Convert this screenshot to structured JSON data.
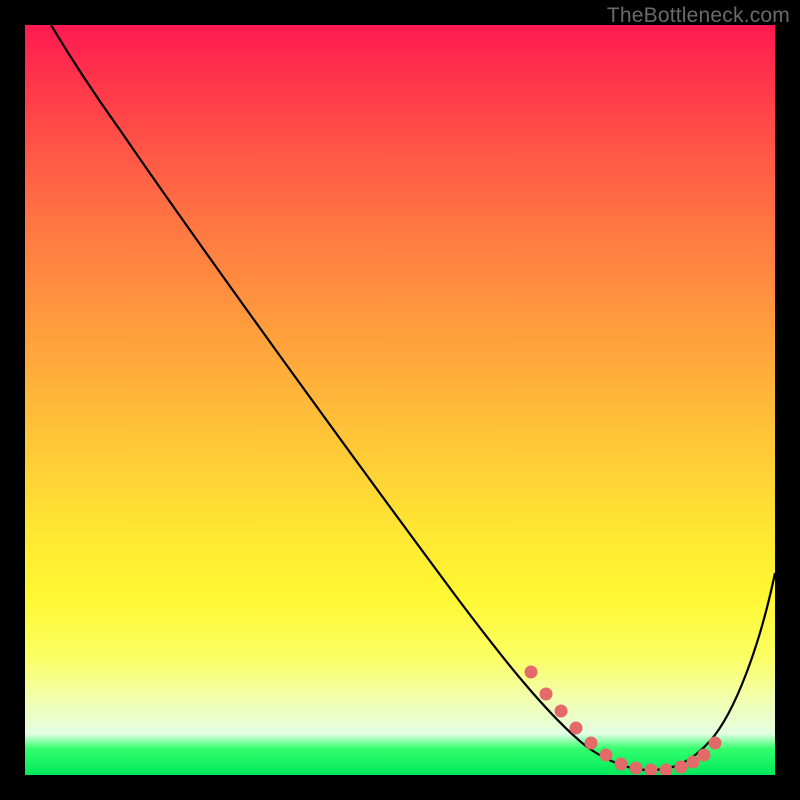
{
  "watermark": "TheBottleneck.com",
  "chart_data": {
    "type": "line",
    "title": "",
    "xlabel": "",
    "ylabel": "",
    "x_range_pct": [
      0,
      100
    ],
    "y_range_pct": [
      0,
      100
    ],
    "background_gradient_stops": [
      {
        "pct": 0,
        "color": "#ff1a51"
      },
      {
        "pct": 9,
        "color": "#ff3b4a"
      },
      {
        "pct": 18,
        "color": "#ff5a46"
      },
      {
        "pct": 28,
        "color": "#ff7a42"
      },
      {
        "pct": 38,
        "color": "#ff963e"
      },
      {
        "pct": 48,
        "color": "#ffb23a"
      },
      {
        "pct": 58,
        "color": "#ffcd36"
      },
      {
        "pct": 68,
        "color": "#ffe833"
      },
      {
        "pct": 76,
        "color": "#fff731"
      },
      {
        "pct": 84,
        "color": "#fbff60"
      },
      {
        "pct": 90,
        "color": "#f2ffb0"
      },
      {
        "pct": 94.5,
        "color": "#e3ffe3"
      },
      {
        "pct": 96.5,
        "color": "#33ff6e"
      },
      {
        "pct": 100,
        "color": "#00e85a"
      }
    ],
    "series": [
      {
        "name": "bottleneck-curve",
        "color": "#000000",
        "x_pct": [
          3.5,
          10,
          20,
          30,
          40,
          50,
          60,
          67,
          73,
          78,
          82,
          86,
          90,
          95,
          100
        ],
        "y_pct": [
          100,
          92,
          80,
          67,
          53,
          40,
          27,
          16,
          7,
          2,
          0.7,
          0.7,
          2,
          11,
          27
        ]
      }
    ],
    "highlight_trough": {
      "name": "trough-dots",
      "color": "#e46a6a",
      "x_pct": [
        67.5,
        69.5,
        71.5,
        73.5,
        75.5,
        77.5,
        79.5,
        81.5,
        83.5,
        85.5,
        87.5,
        89,
        90.5,
        92
      ],
      "y_pct": [
        13.7,
        10.8,
        8.5,
        6.3,
        4.3,
        2.7,
        1.5,
        0.9,
        0.7,
        0.7,
        1.1,
        1.7,
        2.7,
        4.3
      ]
    }
  }
}
